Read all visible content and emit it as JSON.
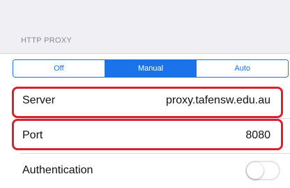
{
  "proxy": {
    "section_header": "HTTP PROXY",
    "modes": [
      {
        "label": "Off",
        "selected": false
      },
      {
        "label": "Manual",
        "selected": true
      },
      {
        "label": "Auto",
        "selected": false
      }
    ],
    "server": {
      "label": "Server",
      "value": "proxy.tafensw.edu.au"
    },
    "port": {
      "label": "Port",
      "value": "8080"
    },
    "authentication": {
      "label": "Authentication",
      "enabled": false
    }
  },
  "colors": {
    "accent": "#1a73e8",
    "highlight": "#d9222f",
    "background": "#efeff4"
  }
}
